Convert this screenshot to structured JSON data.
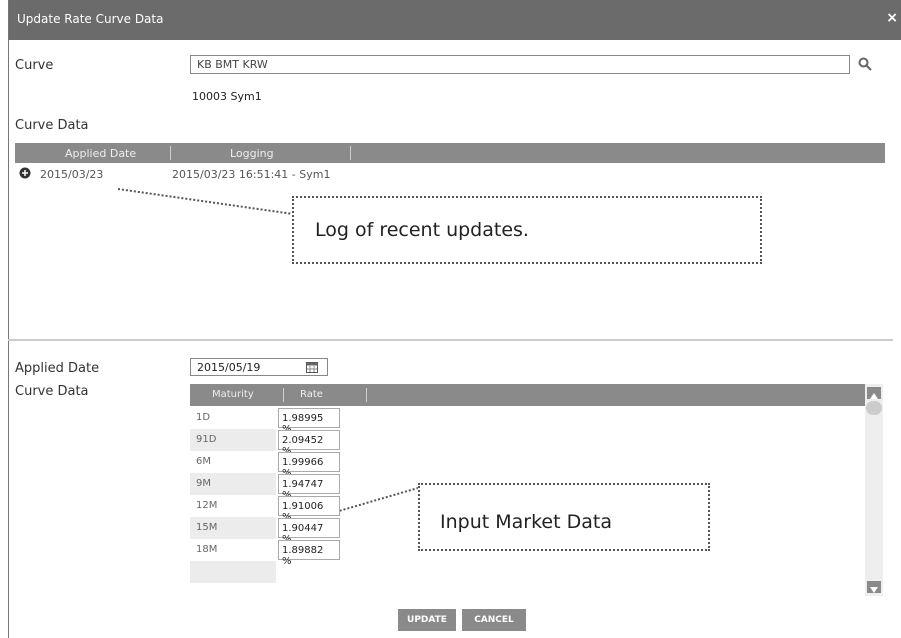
{
  "dialog": {
    "title": "Update Rate Curve Data"
  },
  "labels": {
    "curve": "Curve",
    "curve_data": "Curve Data",
    "applied_date": "Applied Date",
    "curve_data_2": "Curve Data"
  },
  "curve": {
    "value": "KB BMT KRW",
    "name": "10003 Sym1"
  },
  "log_table": {
    "headers": [
      "Applied Date",
      "Logging"
    ],
    "rows": [
      {
        "applied_date": "2015/03/23",
        "logging": "2015/03/23 16:51:41 - Sym1"
      }
    ]
  },
  "applied_date_value": "2015/05/19",
  "rate_table": {
    "headers": [
      "Maturity",
      "Rate"
    ],
    "rows": [
      {
        "maturity": "1D",
        "rate": "1.98995 %"
      },
      {
        "maturity": "91D",
        "rate": "2.09452 %"
      },
      {
        "maturity": "6M",
        "rate": "1.99966 %"
      },
      {
        "maturity": "9M",
        "rate": "1.94747 %"
      },
      {
        "maturity": "12M",
        "rate": "1.91006 %"
      },
      {
        "maturity": "15M",
        "rate": "1.90447 %"
      },
      {
        "maturity": "18M",
        "rate": "1.89882 %"
      }
    ]
  },
  "buttons": {
    "update": "UPDATE",
    "cancel": "CANCEL"
  },
  "callouts": {
    "log": "Log of recent updates.",
    "input": "Input Market Data"
  },
  "colors": {
    "titlebar": "#6b6b6b",
    "header": "#8a8a8a"
  },
  "icons": {
    "close": "close-icon",
    "search": "search-icon",
    "expand": "plus-icon",
    "calendar": "calendar-icon"
  }
}
